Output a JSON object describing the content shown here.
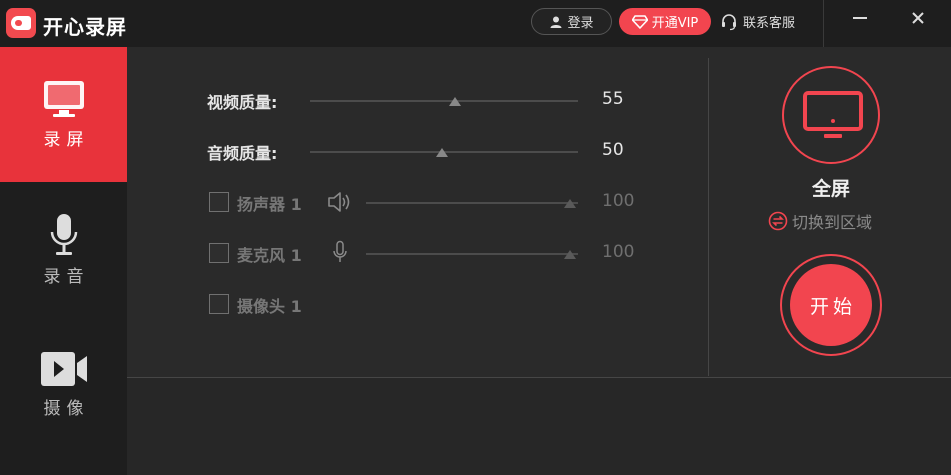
{
  "app": {
    "title": "开心录屏"
  },
  "header": {
    "login_label": "登录",
    "vip_label": "开通VIP",
    "service_label": "联系客服"
  },
  "sidebar": {
    "items": [
      {
        "label": "录屏",
        "icon": "monitor-icon",
        "active": true
      },
      {
        "label": "录音",
        "icon": "microphone-icon",
        "active": false
      },
      {
        "label": "摄像",
        "icon": "video-camera-icon",
        "active": false
      }
    ]
  },
  "settings": {
    "video_quality": {
      "label": "视频质量:",
      "value": 55
    },
    "audio_quality": {
      "label": "音频质量:",
      "value": 50
    },
    "speaker": {
      "label": "扬声器 1",
      "value": 100,
      "checked": false
    },
    "microphone": {
      "label": "麦克风 1",
      "value": 100,
      "checked": false
    },
    "camera": {
      "label": "摄像头 1",
      "checked": false
    }
  },
  "capture": {
    "mode_label": "全屏",
    "switch_label": "切换到区域",
    "start_label": "开始"
  },
  "colors": {
    "accent": "#f2454f",
    "sidebar_active": "#e8333b",
    "background": "#2a2a2a"
  }
}
